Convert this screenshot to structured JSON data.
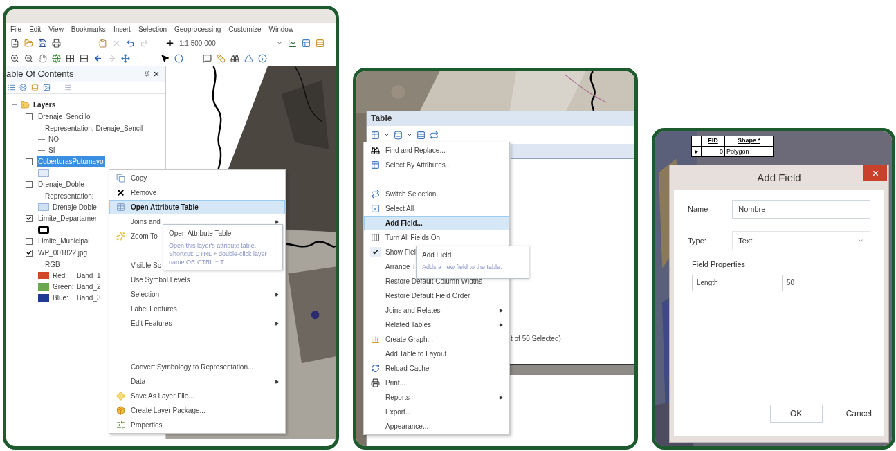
{
  "arcmap": {
    "menu_bar": [
      "File",
      "Edit",
      "View",
      "Bookmarks",
      "Insert",
      "Selection",
      "Geoprocessing",
      "Customize",
      "Window"
    ],
    "scale": "1:1 500 000",
    "toc": {
      "title": "able Of Contents",
      "tree": {
        "label": "Layers",
        "expanded": true,
        "children": [
          {
            "kind": "layer",
            "label": "Drenaje_Sencillo",
            "checked": false,
            "selected": false,
            "children": [
              {
                "kind": "text",
                "label": "Representation: Drenaje_Sencil"
              },
              {
                "kind": "line",
                "label": "NO"
              },
              {
                "kind": "line",
                "label": "SI"
              }
            ]
          },
          {
            "kind": "layer",
            "label": "CoberturasPutumayo",
            "checked": false,
            "selected": true,
            "children": [
              {
                "kind": "fill",
                "color": "#e4ecf7"
              }
            ]
          },
          {
            "kind": "layer",
            "label": "Drenaje_Doble",
            "checked": false,
            "selected": false,
            "children": [
              {
                "kind": "text",
                "label": "Representation:"
              },
              {
                "kind": "fill",
                "label": "Drenaje Doble",
                "color": "#cfe2f3"
              }
            ]
          },
          {
            "kind": "layer",
            "label": "Limite_Departamer",
            "checked": true,
            "selected": false,
            "children": [
              {
                "kind": "outline"
              }
            ]
          },
          {
            "kind": "layer",
            "label": "Limite_Municipal",
            "checked": false,
            "selected": false
          },
          {
            "kind": "layer",
            "label": "WP_001822.jpg",
            "checked": true,
            "selected": false,
            "children": [
              {
                "kind": "text",
                "label": "RGB"
              },
              {
                "kind": "band",
                "label": "Red:",
                "value": "Band_1",
                "color": "#d2462a"
              },
              {
                "kind": "band",
                "label": "Green:",
                "value": "Band_2",
                "color": "#6aa84f"
              },
              {
                "kind": "band",
                "label": "Blue:",
                "value": "Band_3",
                "color": "#1f3a93"
              }
            ]
          }
        ]
      }
    },
    "context_menu": [
      {
        "kind": "item",
        "label": "Copy",
        "selected": false,
        "submenu": false
      },
      {
        "kind": "item",
        "label": "Remove",
        "selected": false,
        "submenu": false
      },
      {
        "kind": "item",
        "label": "Open Attribute Table",
        "selected": true,
        "submenu": false
      },
      {
        "kind": "item",
        "label": "Joins and",
        "selected": false,
        "submenu": true
      },
      {
        "kind": "item",
        "label": "Zoom To",
        "selected": false
      },
      {
        "kind": "gap"
      },
      {
        "kind": "item",
        "label": "Visible Sc",
        "selected": false
      },
      {
        "kind": "item",
        "label": "Use Symbol Levels",
        "selected": false,
        "submenu": false
      },
      {
        "kind": "item",
        "label": "Selection",
        "selected": false,
        "submenu": true
      },
      {
        "kind": "item",
        "label": "Label Features",
        "selected": false,
        "submenu": false
      },
      {
        "kind": "item",
        "label": "Edit Features",
        "selected": false,
        "submenu": true
      },
      {
        "kind": "gap"
      },
      {
        "kind": "gap"
      },
      {
        "kind": "item",
        "label": "Convert Symbology to Representation...",
        "selected": false,
        "submenu": false
      },
      {
        "kind": "item",
        "label": "Data",
        "selected": false,
        "submenu": true
      },
      {
        "kind": "item",
        "label": "Save As Layer File...",
        "selected": false,
        "submenu": false
      },
      {
        "kind": "item",
        "label": "Create Layer Package...",
        "selected": false,
        "submenu": false
      },
      {
        "kind": "item",
        "label": "Properties...",
        "selected": false,
        "submenu": false
      }
    ],
    "tooltip": {
      "title": "Open Attribute Table",
      "text": "Open this layer's attribute table. Shortcut: CTRL + double-click layer name OR CTRL + T."
    }
  },
  "table_window": {
    "title": "Table",
    "menu": [
      {
        "kind": "item",
        "label": "Find and Replace...",
        "selected": false,
        "checked": false,
        "submenu": false
      },
      {
        "kind": "item",
        "label": "Select By Attributes...",
        "selected": false,
        "checked": false,
        "submenu": false
      },
      {
        "kind": "gap"
      },
      {
        "kind": "item",
        "label": "Switch Selection",
        "selected": false,
        "checked": false,
        "submenu": false
      },
      {
        "kind": "item",
        "label": "Select All",
        "selected": false,
        "checked": false,
        "submenu": false
      },
      {
        "kind": "item",
        "label": "Add Field...",
        "selected": true,
        "checked": false,
        "submenu": false
      },
      {
        "kind": "item",
        "label": "Turn All Fields On",
        "selected": false,
        "checked": false,
        "submenu": false
      },
      {
        "kind": "item",
        "label": "Show Fiel",
        "selected": false,
        "checked": true
      },
      {
        "kind": "item",
        "label": "Arrange T",
        "selected": false,
        "checked": false
      },
      {
        "kind": "item",
        "label": "Restore Default Column Widths",
        "selected": false,
        "checked": false,
        "submenu": false
      },
      {
        "kind": "item",
        "label": "Restore Default Field Order",
        "selected": false,
        "checked": false,
        "submenu": false
      },
      {
        "kind": "item",
        "label": "Joins and Relates",
        "selected": false,
        "checked": false,
        "submenu": true
      },
      {
        "kind": "item",
        "label": "Related Tables",
        "selected": false,
        "checked": false,
        "submenu": true
      },
      {
        "kind": "item",
        "label": "Create Graph...",
        "selected": false,
        "checked": false,
        "submenu": false
      },
      {
        "kind": "item",
        "label": "Add Table to Layout",
        "selected": false,
        "checked": false,
        "submenu": false
      },
      {
        "kind": "item",
        "label": "Reload Cache",
        "selected": false,
        "checked": false,
        "submenu": false
      },
      {
        "kind": "item",
        "label": "Print...",
        "selected": false,
        "checked": false,
        "submenu": false
      },
      {
        "kind": "item",
        "label": "Reports",
        "selected": false,
        "checked": false,
        "submenu": true
      },
      {
        "kind": "item",
        "label": "Export...",
        "selected": false,
        "checked": false,
        "submenu": false
      },
      {
        "kind": "item",
        "label": "Appearance...",
        "selected": false,
        "checked": false,
        "submenu": false
      }
    ],
    "tooltip": {
      "title": "Add Field",
      "text": "Adds a new field to the table."
    },
    "selection_text": "t of 50 Selected)"
  },
  "add_field": {
    "attribute_table": {
      "columns": [
        "FID",
        "Shape *"
      ],
      "rows": [
        {
          "current": true,
          "cells": [
            "0",
            "Polygon"
          ]
        }
      ]
    },
    "title": "Add Field",
    "name_label": "Name",
    "name_value": "Nombre",
    "type_label": "Type:",
    "type_value": "Text",
    "properties_title": "Field Properties",
    "properties": [
      {
        "name": "Length",
        "value": "50"
      }
    ],
    "buttons": [
      "OK",
      "Cancel"
    ]
  }
}
